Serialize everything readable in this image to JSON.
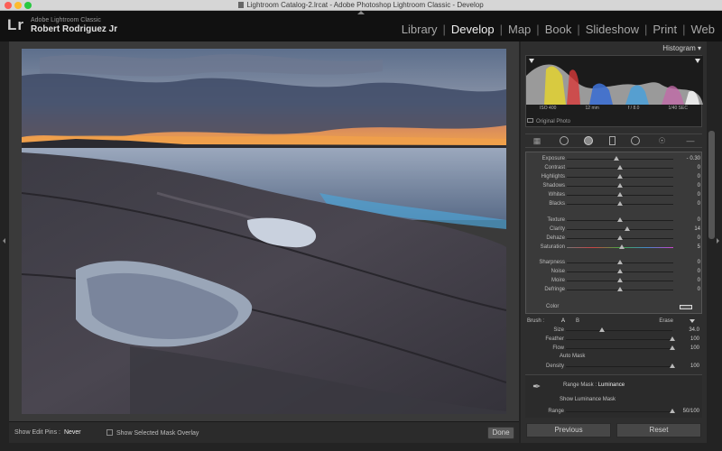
{
  "window": {
    "title": "Lightroom Catalog-2.lrcat - Adobe Photoshop Lightroom Classic - Develop"
  },
  "identity": {
    "logo": "Lr",
    "app_name": "Adobe Lightroom Classic",
    "user": "Robert Rodriguez Jr"
  },
  "modules": [
    {
      "label": "Library",
      "active": false
    },
    {
      "label": "Develop",
      "active": true
    },
    {
      "label": "Map",
      "active": false
    },
    {
      "label": "Book",
      "active": false
    },
    {
      "label": "Slideshow",
      "active": false
    },
    {
      "label": "Print",
      "active": false
    },
    {
      "label": "Web",
      "active": false
    }
  ],
  "histogram": {
    "title": "Histogram",
    "exif": {
      "iso": "ISO 400",
      "focal": "12 mm",
      "aperture": "f / 8.0",
      "shutter": "1/40 SEC"
    },
    "original_label": "Original Photo"
  },
  "adjustments": [
    {
      "label": "Exposure",
      "value": "- 0.30",
      "level": 0.47
    },
    {
      "label": "Contrast",
      "value": "0",
      "level": 0.5
    },
    {
      "label": "Highlights",
      "value": "0",
      "level": 0.5
    },
    {
      "label": "Shadows",
      "value": "0",
      "level": 0.5
    },
    {
      "label": "Whites",
      "value": "0",
      "level": 0.5
    },
    {
      "label": "Blacks",
      "value": "0",
      "level": 0.5
    },
    {
      "label": "Texture",
      "value": "0",
      "level": 0.5
    },
    {
      "label": "Clarity",
      "value": "14",
      "level": 0.57
    },
    {
      "label": "Dehaze",
      "value": "0",
      "level": 0.5
    },
    {
      "label": "Saturation",
      "value": "5",
      "level": 0.52
    },
    {
      "label": "Sharpness",
      "value": "0",
      "level": 0.5
    },
    {
      "label": "Noise",
      "value": "0",
      "level": 0.5
    },
    {
      "label": "Moire",
      "value": "0",
      "level": 0.5
    },
    {
      "label": "Defringe",
      "value": "0",
      "level": 0.5
    }
  ],
  "color_label": "Color",
  "brush": {
    "label": "Brush :",
    "a": "A",
    "b": "B",
    "erase": "Erase",
    "rows": [
      {
        "label": "Size",
        "value": "34.0",
        "level": 0.34
      },
      {
        "label": "Feather",
        "value": "100",
        "level": 1.0
      },
      {
        "label": "Flow",
        "value": "100",
        "level": 1.0
      },
      {
        "label": "Density",
        "value": "100",
        "level": 1.0
      }
    ],
    "auto_mask": "Auto Mask"
  },
  "range_mask": {
    "label": "Range Mask :",
    "value": "Luminance",
    "show_label": "Show Luminance Mask",
    "range_label": "Range",
    "range_value": "50/100"
  },
  "toolbar": {
    "show_edit_pins": "Show Edit Pins :",
    "pins_value": "Never",
    "show_overlay": "Show Selected Mask Overlay",
    "done": "Done"
  },
  "footer": {
    "previous": "Previous",
    "reset": "Reset"
  },
  "colors": {
    "accent": "#f0f0f0",
    "panel": "#2e2e2e"
  }
}
